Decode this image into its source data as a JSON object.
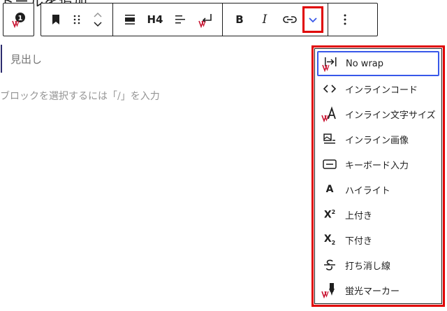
{
  "partial_title": "トールを追加",
  "block_toolbar": {
    "plugin_badge": "1",
    "heading_level": "H4"
  },
  "editor": {
    "heading_placeholder": "見出し",
    "block_placeholder": "ブロックを選択するには「/」を入力"
  },
  "dropdown": {
    "items": [
      {
        "label": "No wrap",
        "icon": "no-wrap-icon"
      },
      {
        "label": "インラインコード",
        "icon": "code-icon"
      },
      {
        "label": "インライン文字サイズ",
        "icon": "font-size-icon"
      },
      {
        "label": "インライン画像",
        "icon": "inline-image-icon"
      },
      {
        "label": "キーボード入力",
        "icon": "keyboard-icon"
      },
      {
        "label": "ハイライト",
        "icon": "highlight-icon"
      },
      {
        "label": "上付き",
        "icon": "superscript-icon"
      },
      {
        "label": "下付き",
        "icon": "subscript-icon"
      },
      {
        "label": "打ち消し線",
        "icon": "strikethrough-icon"
      },
      {
        "label": "蛍光マーカー",
        "icon": "marker-icon"
      }
    ],
    "highlight_glyph": "A",
    "superscript_glyph": "X",
    "superscript_mark": "2",
    "subscript_glyph": "X",
    "subscript_mark": "2"
  },
  "colors": {
    "accent": "#3858e9",
    "annotation_red": "#e00000",
    "plugin_red": "#c8102e"
  }
}
